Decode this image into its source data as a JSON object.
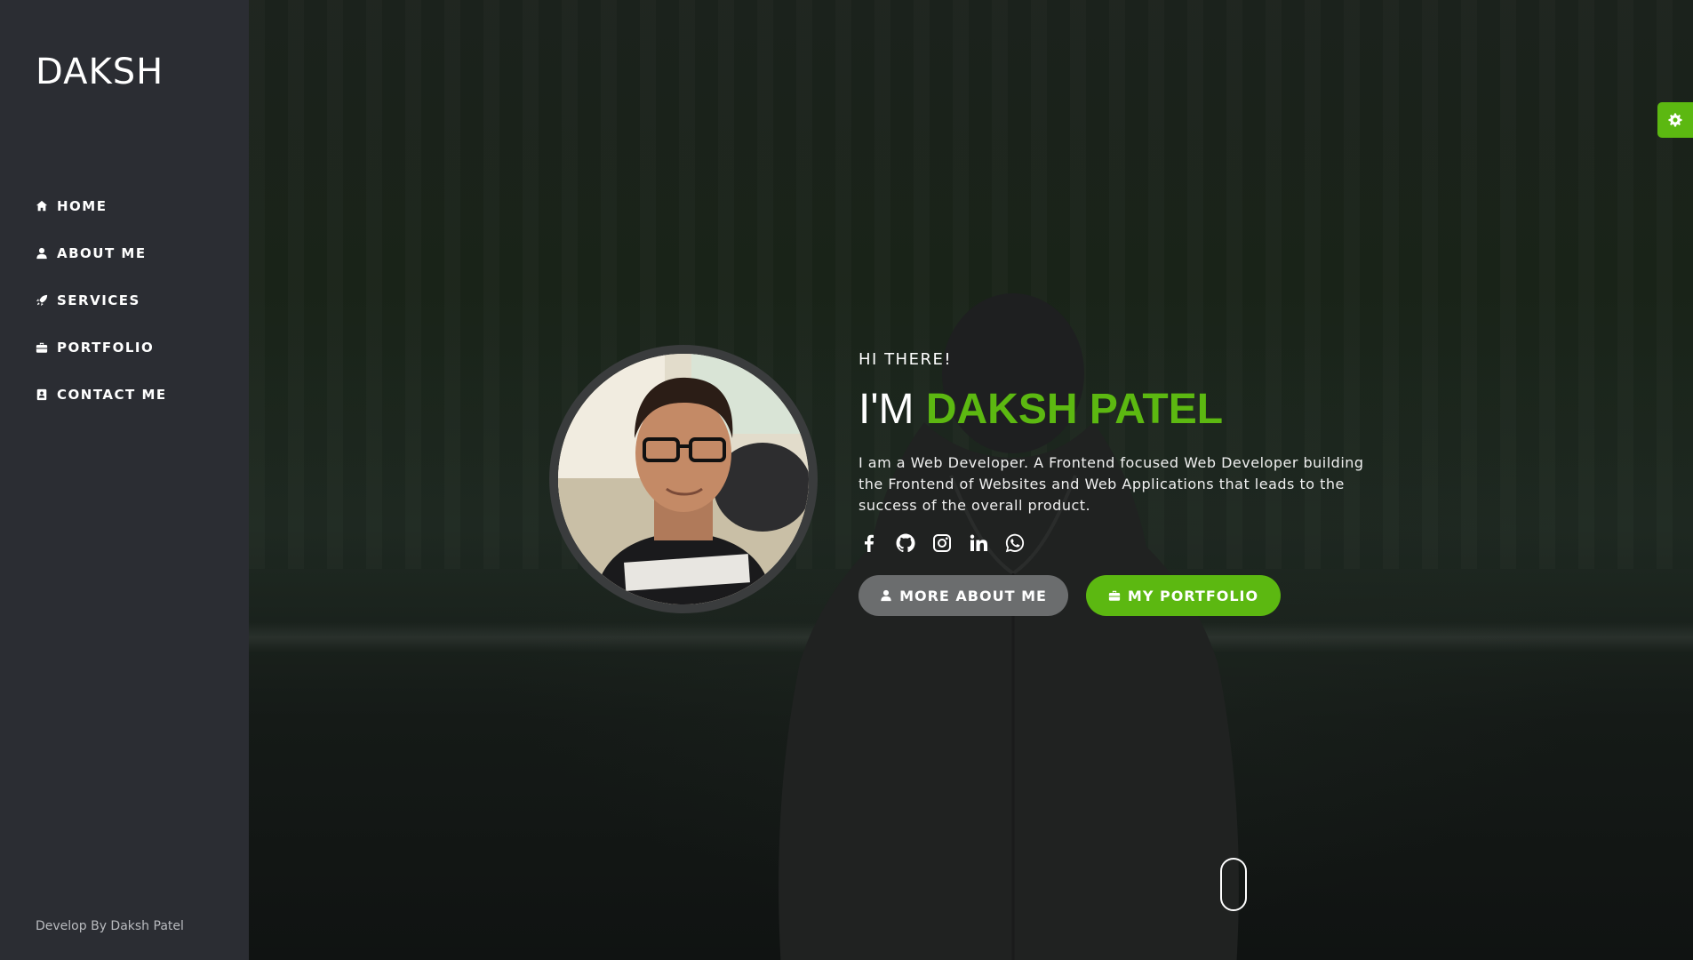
{
  "brand": "DAKSH",
  "nav": [
    {
      "label": "HOME",
      "icon": "home-icon"
    },
    {
      "label": "ABOUT ME",
      "icon": "user-icon"
    },
    {
      "label": "SERVICES",
      "icon": "rocket-icon"
    },
    {
      "label": "PORTFOLIO",
      "icon": "briefcase-icon"
    },
    {
      "label": "CONTACT ME",
      "icon": "address-book-icon"
    }
  ],
  "footer": "Develop By Daksh Patel",
  "hero": {
    "greeting": "HI THERE!",
    "headline_prefix": "I'M ",
    "headline_name": "DAKSH PATEL",
    "bio": "I am a Web Developer. A Frontend focused Web Developer building the Frontend of Websites and Web Applications that leads to the success of the overall product.",
    "socials": [
      "facebook-icon",
      "github-icon",
      "instagram-icon",
      "linkedin-icon",
      "whatsapp-icon"
    ],
    "buttons": {
      "about": "MORE ABOUT ME",
      "portfolio": "MY PORTFOLIO"
    }
  },
  "colors": {
    "accent": "#5cb811",
    "sidebar": "#2b2d33",
    "button_secondary": "#6b6d6e"
  }
}
